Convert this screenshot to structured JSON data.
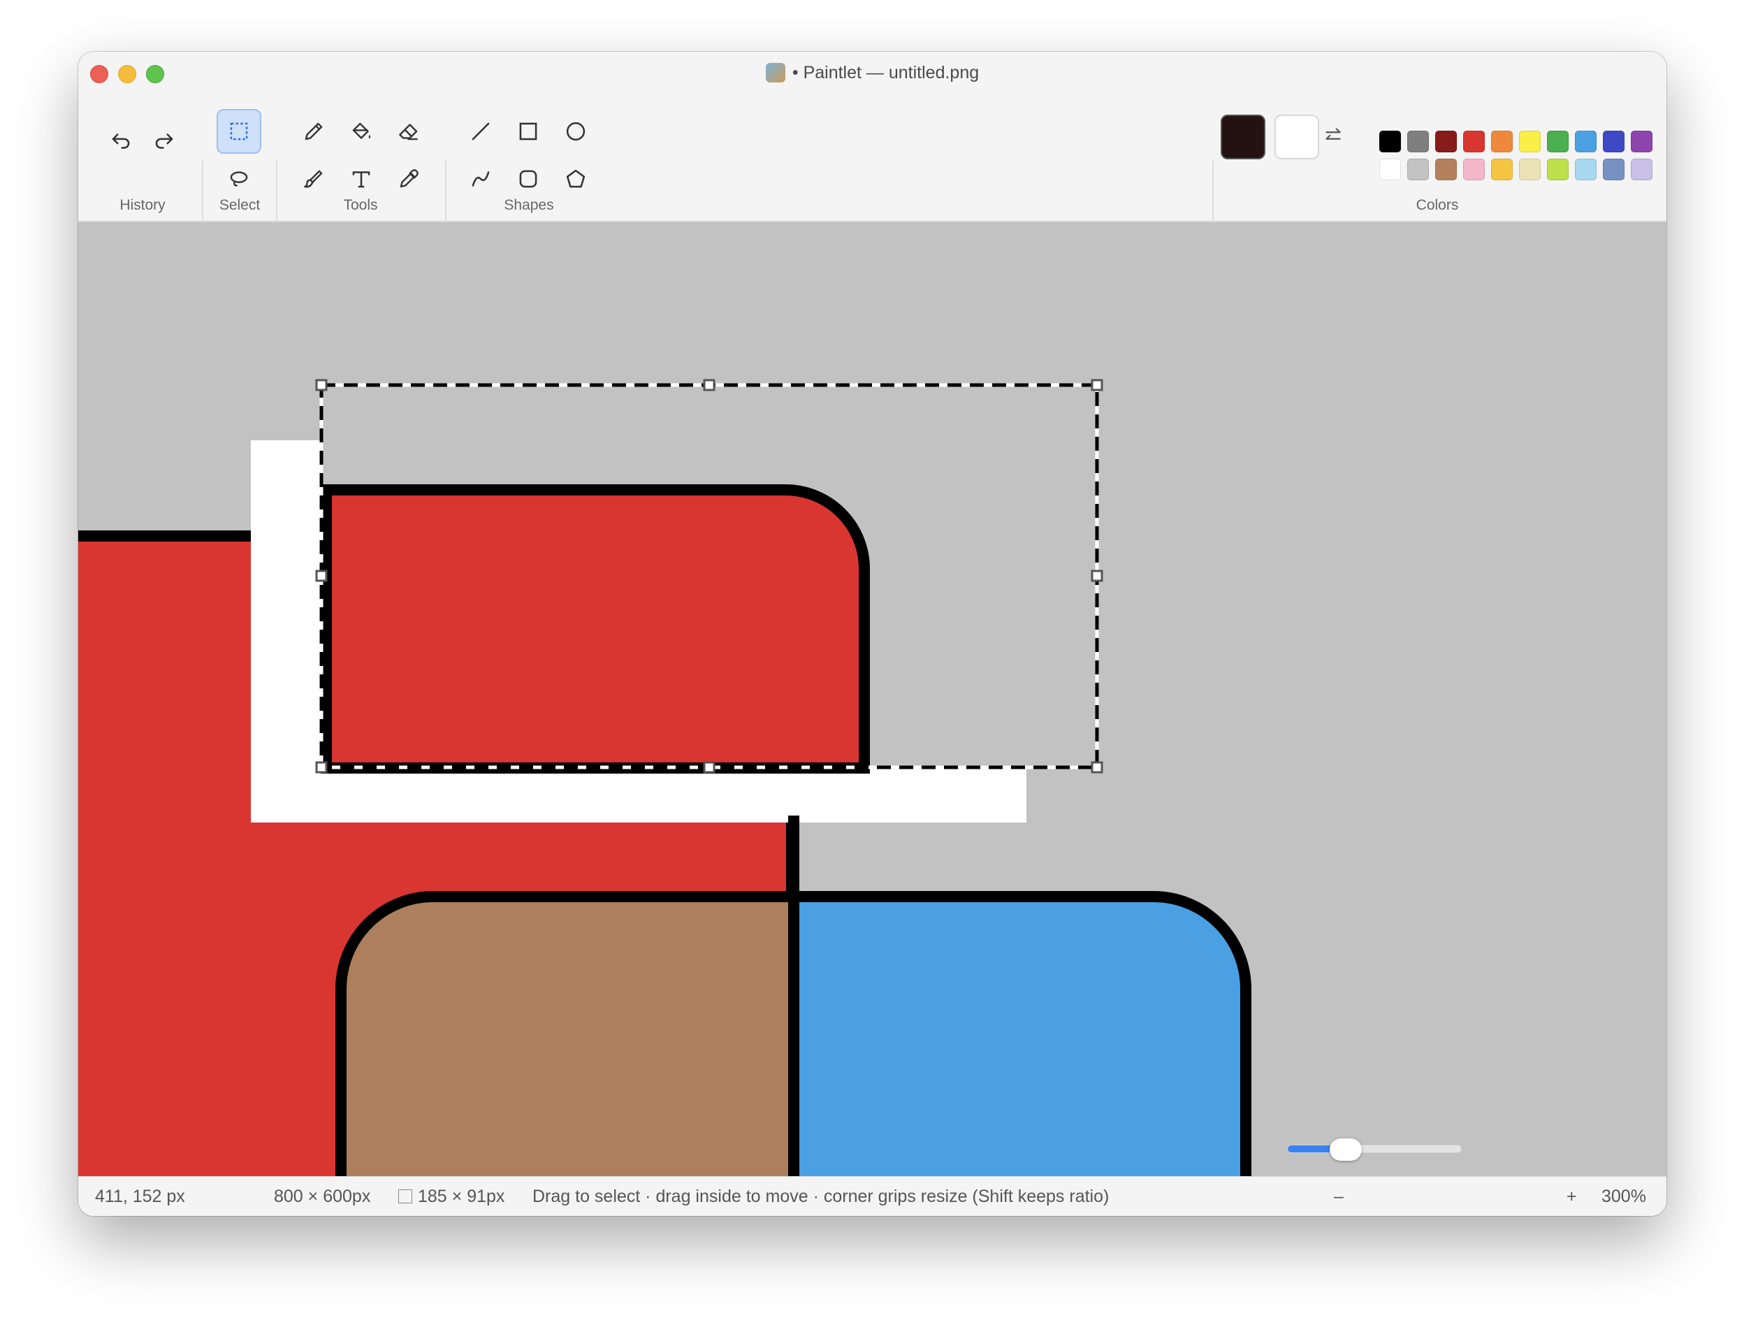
{
  "window": {
    "title": "Paintlet — untitled.png",
    "title_prefix": "•",
    "app_icon": "paint-palette-icon"
  },
  "toolbar": {
    "groups": {
      "history": "History",
      "select": "Select",
      "tools": "Tools",
      "shapes": "Shapes",
      "colors": "Colors"
    },
    "history_tools": [
      "undo-icon",
      "redo-icon"
    ],
    "select_tools": [
      "rectangle-select-icon",
      "lasso-select-icon"
    ],
    "active_tool": "rectangle-select",
    "drawing_tools": [
      "pencil-icon",
      "fill-bucket-icon",
      "eraser-icon",
      "brush-icon",
      "text-icon",
      "eyedropper-icon"
    ],
    "shape_tools": [
      "line-icon",
      "rectangle-icon",
      "ellipse-icon",
      "curve-icon",
      "rounded-rectangle-icon",
      "polygon-icon"
    ]
  },
  "colors": {
    "primary": "#241212",
    "secondary": "#ffffff",
    "swap_icon": "swap-arrows-icon",
    "palette_row1": [
      "#000000",
      "#7f7f7f",
      "#871a1a",
      "#d93631",
      "#f0883b",
      "#f9ef47",
      "#4caf50",
      "#4aa0e2",
      "#3f49c6",
      "#8e44ad"
    ],
    "palette_row2": [
      "#ffffff",
      "#c3c3c3",
      "#b5805d",
      "#f4b6c8",
      "#f5c542",
      "#ebe3b6",
      "#bde04a",
      "#a8d8ef",
      "#7691c2",
      "#c8c0e6"
    ]
  },
  "canvas_scene": {
    "background": "#c2c2c2",
    "red": "#d93631",
    "brown": "#ad7f5d",
    "blue": "#4aa0e2",
    "outline": "#000000",
    "white": "#ffffff"
  },
  "status": {
    "cursor": "411, 152 px",
    "image_size": "800 × 600px",
    "selection_size": "185 × 91px",
    "hint": "Drag to select · drag inside to move · corner grips resize (Shift keeps ratio)",
    "zoom_minus": "–",
    "zoom_plus": "+",
    "zoom_level": "300%",
    "zoom_slider_value": 0.33
  }
}
